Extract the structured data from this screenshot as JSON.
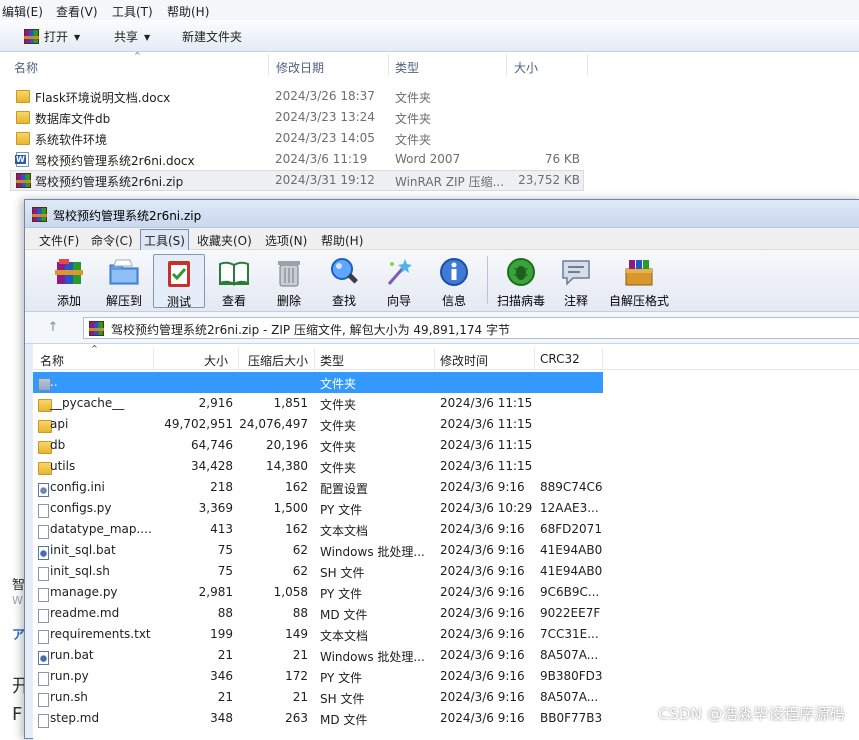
{
  "explorer": {
    "menu": [
      "编辑(E)",
      "查看(V)",
      "工具(T)",
      "帮助(H)"
    ],
    "toolbar": {
      "open": "打开",
      "share": "共享",
      "new_folder": "新建文件夹"
    },
    "columns": {
      "name": "名称",
      "date": "修改日期",
      "type": "类型",
      "size": "大小"
    },
    "files": [
      {
        "name": "Flask环境说明文档.docx",
        "date": "2024/3/26 18:37",
        "type": "文件夹",
        "size": "",
        "icon": "folder-icon"
      },
      {
        "name": "数据库文件db",
        "date": "2024/3/23 13:24",
        "type": "文件夹",
        "size": "",
        "icon": "folder-icon"
      },
      {
        "name": "系统软件环境",
        "date": "2024/3/23 14:05",
        "type": "文件夹",
        "size": "",
        "icon": "folder-icon"
      },
      {
        "name": "驾校预约管理系统2r6ni.docx",
        "date": "2024/3/6 11:19",
        "type": "Word 2007",
        "size": "76 KB",
        "icon": "word-doc-icon"
      },
      {
        "name": "驾校预约管理系统2r6ni.zip",
        "date": "2024/3/31 19:12",
        "type": "WinRAR ZIP 压缩...",
        "size": "23,752 KB",
        "icon": "winrar-zip-icon"
      }
    ],
    "bg_left_texts": [
      "智",
      "W",
      "ア",
      "开",
      "F"
    ]
  },
  "winrar": {
    "title": "驾校预约管理系统2r6ni.zip",
    "menu": [
      "文件(F)",
      "命令(C)",
      "工具(S)",
      "收藏夹(O)",
      "选项(N)",
      "帮助(H)"
    ],
    "tools": [
      "添加",
      "解压到",
      "测试",
      "查看",
      "删除",
      "查找",
      "向导",
      "信息",
      "扫描病毒",
      "注释",
      "自解压格式"
    ],
    "address": "驾校预约管理系统2r6ni.zip - ZIP 压缩文件, 解包大小为 49,891,174 字节",
    "columns": {
      "name": "名称",
      "size": "大小",
      "packed": "压缩后大小",
      "type": "类型",
      "modified": "修改时间",
      "crc": "CRC32"
    },
    "rows": [
      {
        "name": "..",
        "size": "",
        "packed": "",
        "type": "文件夹",
        "modified": "",
        "crc": "",
        "icon": "folder-up-icon"
      },
      {
        "name": "__pycache__",
        "size": "2,916",
        "packed": "1,851",
        "type": "文件夹",
        "modified": "2024/3/6 11:15",
        "crc": "",
        "icon": "folder-icon"
      },
      {
        "name": "api",
        "size": "49,702,951",
        "packed": "24,076,497",
        "type": "文件夹",
        "modified": "2024/3/6 11:15",
        "crc": "",
        "icon": "folder-icon"
      },
      {
        "name": "db",
        "size": "64,746",
        "packed": "20,196",
        "type": "文件夹",
        "modified": "2024/3/6 11:15",
        "crc": "",
        "icon": "folder-icon"
      },
      {
        "name": "utils",
        "size": "34,428",
        "packed": "14,380",
        "type": "文件夹",
        "modified": "2024/3/6 11:15",
        "crc": "",
        "icon": "folder-icon"
      },
      {
        "name": "config.ini",
        "size": "218",
        "packed": "162",
        "type": "配置设置",
        "modified": "2024/3/6 9:16",
        "crc": "889C74C6",
        "icon": "settings-file-icon"
      },
      {
        "name": "configs.py",
        "size": "3,369",
        "packed": "1,500",
        "type": "PY 文件",
        "modified": "2024/3/6 10:29",
        "crc": "12AAE3...",
        "icon": "file-icon"
      },
      {
        "name": "datatype_map....",
        "size": "413",
        "packed": "162",
        "type": "文本文档",
        "modified": "2024/3/6 9:16",
        "crc": "68FD2071",
        "icon": "file-icon"
      },
      {
        "name": "init_sql.bat",
        "size": "75",
        "packed": "62",
        "type": "Windows 批处理...",
        "modified": "2024/3/6 9:16",
        "crc": "41E94AB0",
        "icon": "batch-file-icon"
      },
      {
        "name": "init_sql.sh",
        "size": "75",
        "packed": "62",
        "type": "SH 文件",
        "modified": "2024/3/6 9:16",
        "crc": "41E94AB0",
        "icon": "file-icon"
      },
      {
        "name": "manage.py",
        "size": "2,981",
        "packed": "1,058",
        "type": "PY 文件",
        "modified": "2024/3/6 9:16",
        "crc": "9C6B9C...",
        "icon": "file-icon"
      },
      {
        "name": "readme.md",
        "size": "88",
        "packed": "88",
        "type": "MD 文件",
        "modified": "2024/3/6 9:16",
        "crc": "9022EE7F",
        "icon": "file-icon"
      },
      {
        "name": "requirements.txt",
        "size": "199",
        "packed": "149",
        "type": "文本文档",
        "modified": "2024/3/6 9:16",
        "crc": "7CC31E...",
        "icon": "file-icon"
      },
      {
        "name": "run.bat",
        "size": "21",
        "packed": "21",
        "type": "Windows 批处理...",
        "modified": "2024/3/6 9:16",
        "crc": "8A507A...",
        "icon": "batch-file-icon"
      },
      {
        "name": "run.py",
        "size": "346",
        "packed": "172",
        "type": "PY 文件",
        "modified": "2024/3/6 9:16",
        "crc": "9B380FD3",
        "icon": "file-icon"
      },
      {
        "name": "run.sh",
        "size": "21",
        "packed": "21",
        "type": "SH 文件",
        "modified": "2024/3/6 9:16",
        "crc": "8A507A...",
        "icon": "file-icon"
      },
      {
        "name": "step.md",
        "size": "348",
        "packed": "263",
        "type": "MD 文件",
        "modified": "2024/3/6 9:16",
        "crc": "BB0F77B3",
        "icon": "file-icon"
      }
    ]
  },
  "watermark": "CSDN @浩淼毕设程序源码",
  "colors": {
    "selection": "#3399ff",
    "title_bg": "#c9d8ee",
    "explorer_header": "#4d6185"
  }
}
